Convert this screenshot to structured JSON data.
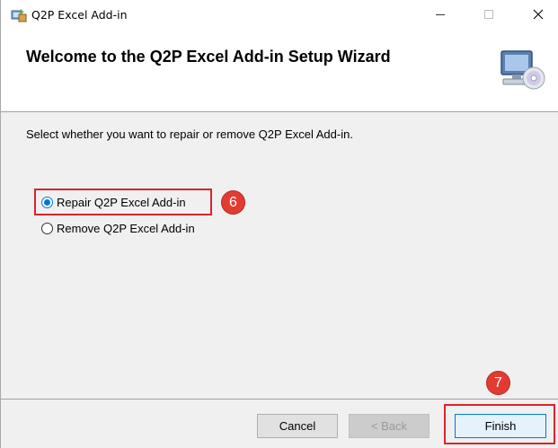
{
  "window": {
    "title": "Q2P Excel Add-in",
    "minimize_glyph": "—",
    "maximize_glyph": "☐",
    "close_glyph": "✕"
  },
  "banner": {
    "title": "Welcome to the Q2P Excel Add-in Setup Wizard",
    "icon": "computer-disc-icon"
  },
  "content": {
    "instruction": "Select whether you want to repair or remove Q2P Excel Add-in.",
    "options": [
      {
        "label": "Repair Q2P Excel Add-in",
        "selected": true
      },
      {
        "label": "Remove Q2P Excel Add-in",
        "selected": false
      }
    ]
  },
  "annotations": {
    "step6": "6",
    "step7": "7",
    "highlight_color": "#d9242c",
    "badge_color": "#e23c32"
  },
  "footer": {
    "cancel_label": "Cancel",
    "back_label": "< Back",
    "finish_label": "Finish"
  },
  "colors": {
    "accent": "#0078d7",
    "dialog_bg": "#f0f0f0"
  }
}
